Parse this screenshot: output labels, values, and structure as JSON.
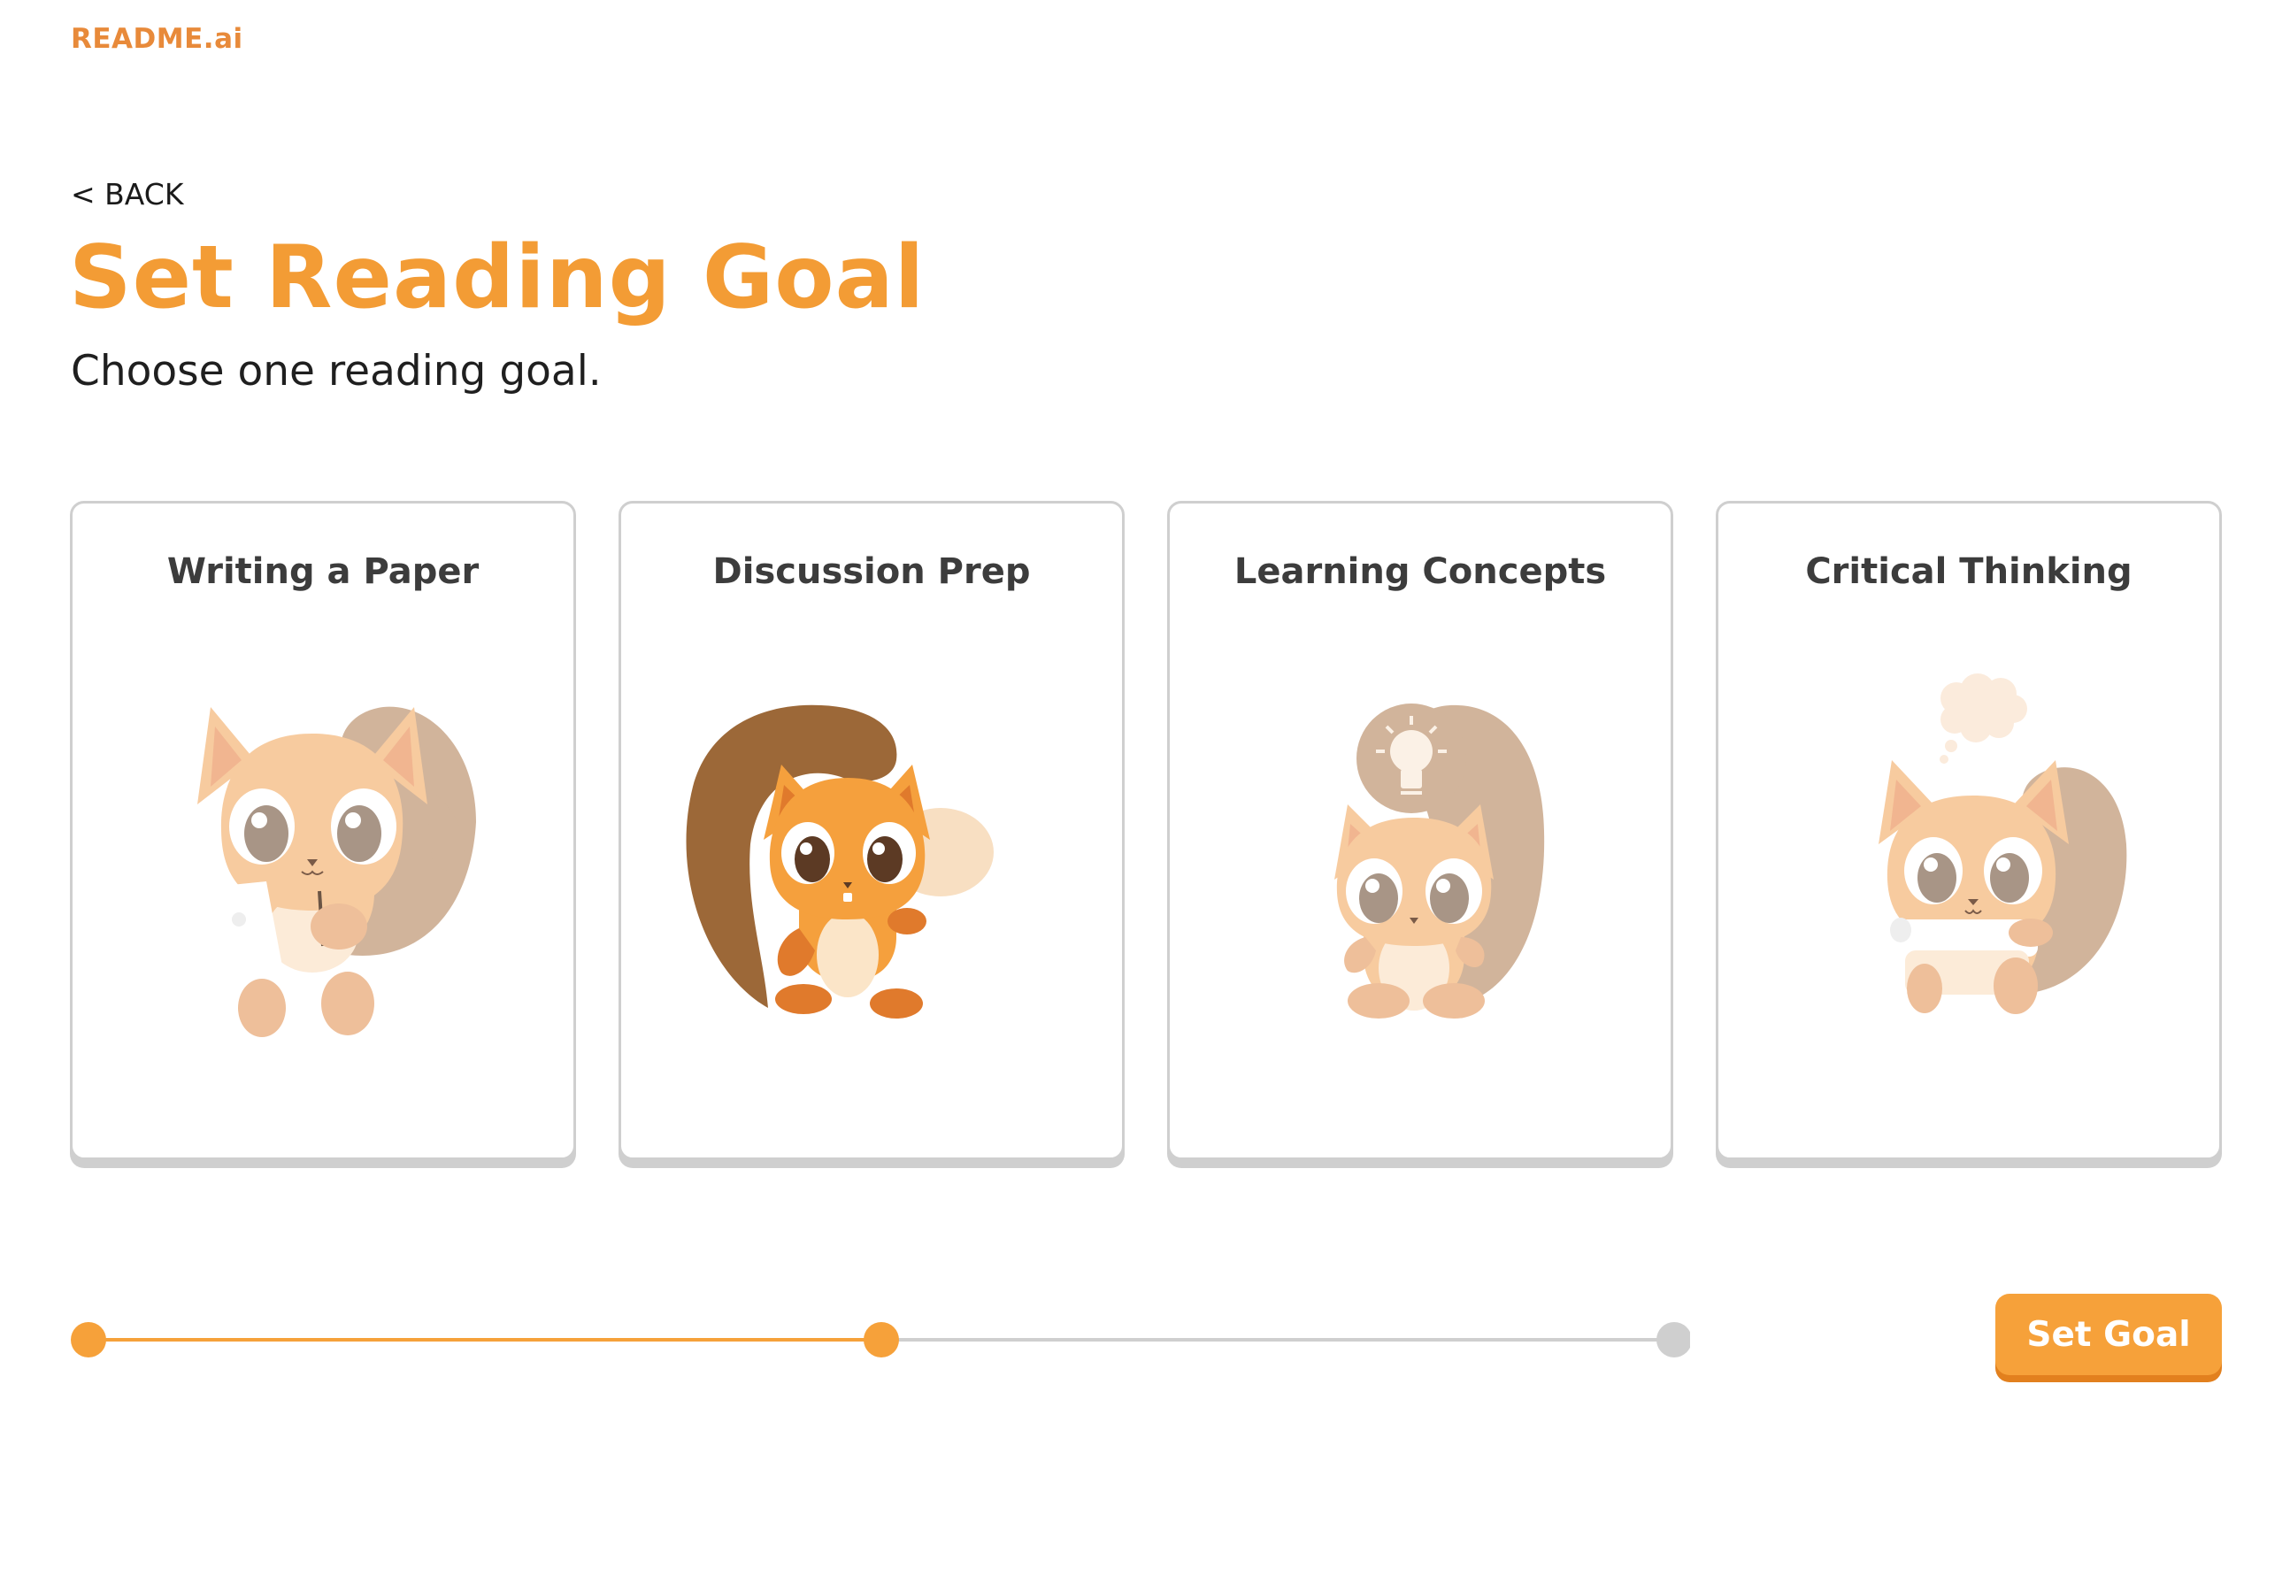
{
  "brand": "README.ai",
  "nav": {
    "back_label": "< BACK"
  },
  "page": {
    "title": "Set Reading Goal",
    "subtitle": "Choose one reading goal."
  },
  "goals": [
    {
      "label": "Writing a Paper",
      "icon": "squirrel-writing-icon"
    },
    {
      "label": "Discussion Prep",
      "icon": "squirrel-speech-bubble-icon"
    },
    {
      "label": "Learning Concepts",
      "icon": "squirrel-lightbulb-icon"
    },
    {
      "label": "Critical Thinking",
      "icon": "squirrel-thought-bubble-icon"
    }
  ],
  "progress": {
    "total_steps": 3,
    "completed_steps": 2
  },
  "cta": {
    "label": "Set Goal"
  },
  "colors": {
    "brand_orange": "#e88a3a",
    "accent_orange": "#f6a13a",
    "inactive_gray": "#cfcfcf",
    "text_dark": "#3c3c3c"
  }
}
